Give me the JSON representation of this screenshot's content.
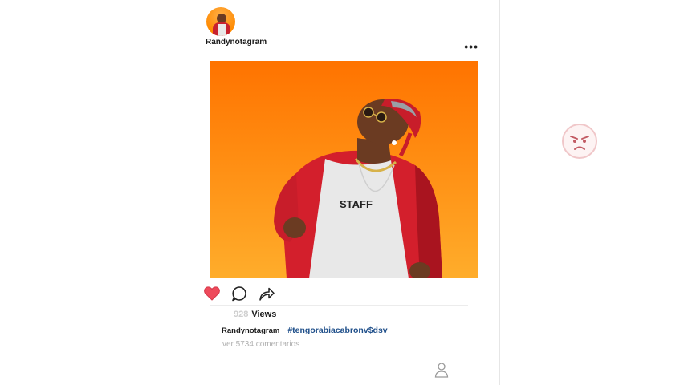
{
  "post": {
    "username": "Randynotagram",
    "more_label": "•••",
    "image_alt": "Man in red jacket and sunglasses against orange background",
    "liked": true,
    "views": {
      "count": "928",
      "label": "Views"
    },
    "caption": {
      "username": "Randynotagram",
      "hashtag": "#tengorabiacabronv$dsv"
    },
    "comments_link": "ver 5734 comentarios"
  },
  "icons": {
    "like": "heart-icon",
    "comment": "comment-icon",
    "share": "share-icon",
    "profile": "user-icon",
    "overlay": "angry-emoji-icon"
  },
  "colors": {
    "like": "#ee4a5b",
    "hashtag": "#1f4f8a",
    "views_count": "#cfcfcf",
    "photo_bg_top": "#ff7300",
    "photo_bg_bottom": "#ffad2b"
  }
}
